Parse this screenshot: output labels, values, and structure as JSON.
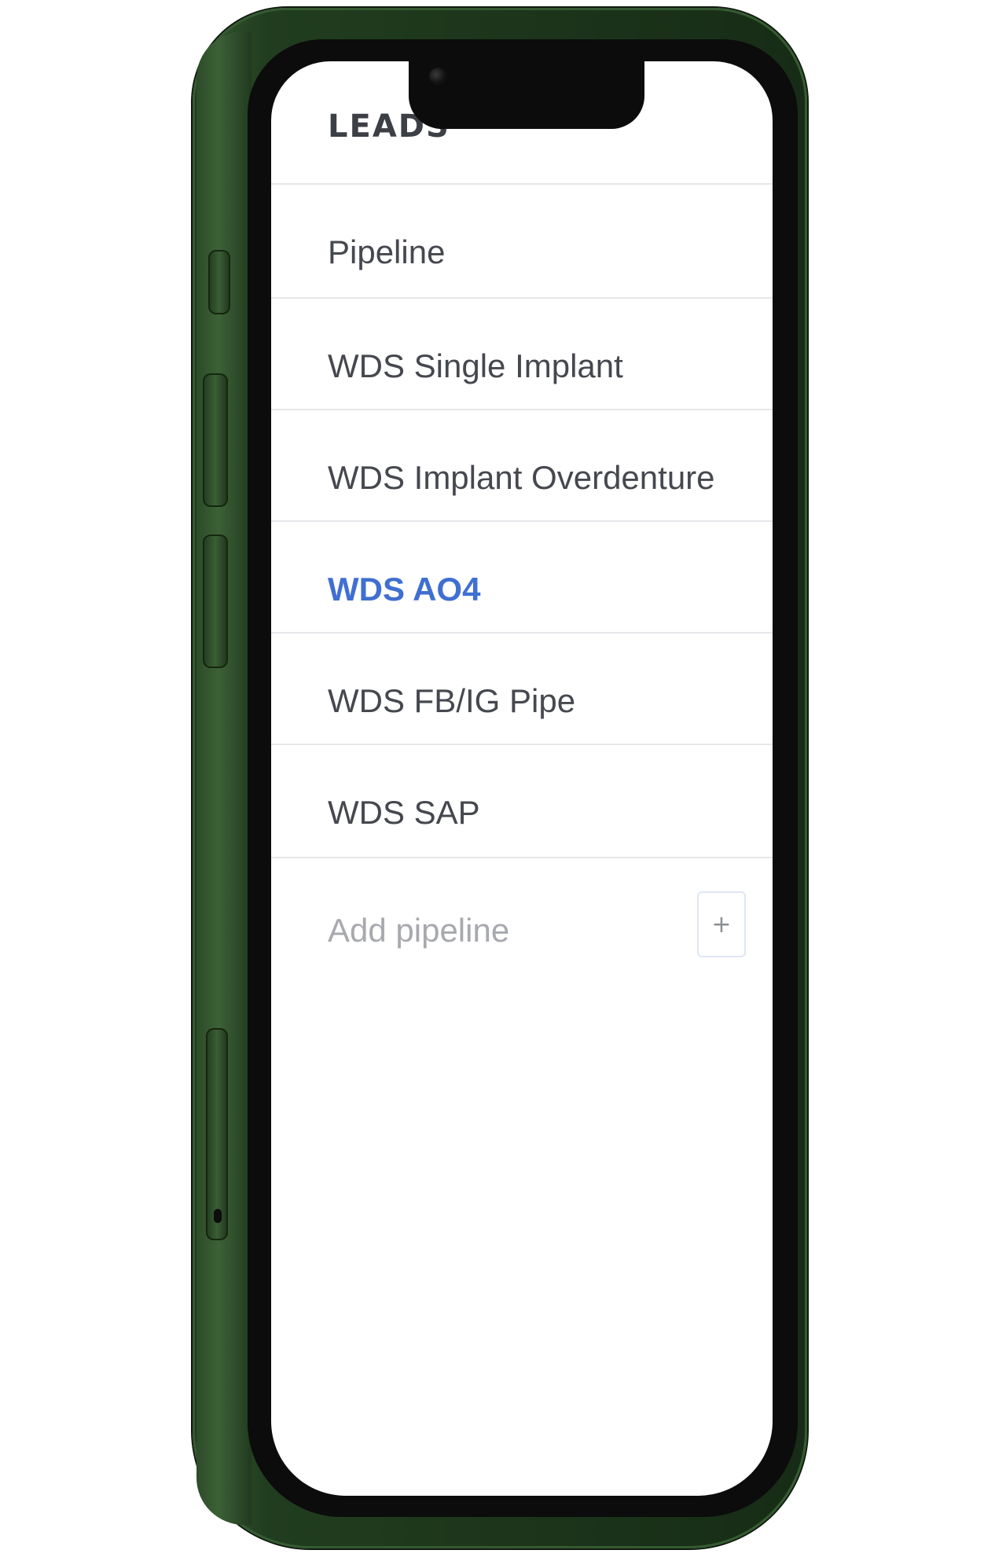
{
  "device": {
    "frame_color": "#2a4726"
  },
  "header": {
    "title": "LEADS"
  },
  "pipelines": [
    {
      "label": "Pipeline",
      "active": false
    },
    {
      "label": "WDS Single Implant",
      "active": false
    },
    {
      "label": "WDS Implant Overdenture",
      "active": false
    },
    {
      "label": "WDS AO4",
      "active": true
    },
    {
      "label": "WDS FB/IG Pipe",
      "active": false
    },
    {
      "label": "WDS SAP",
      "active": false
    }
  ],
  "add_pipeline": {
    "label": "Add pipeline",
    "button_icon": "plus-icon",
    "button_glyph": "+"
  },
  "colors": {
    "active_text": "#3f6fd1",
    "text": "#46484f",
    "muted_text": "#a7a9ae",
    "divider": "#e6e7ea"
  }
}
